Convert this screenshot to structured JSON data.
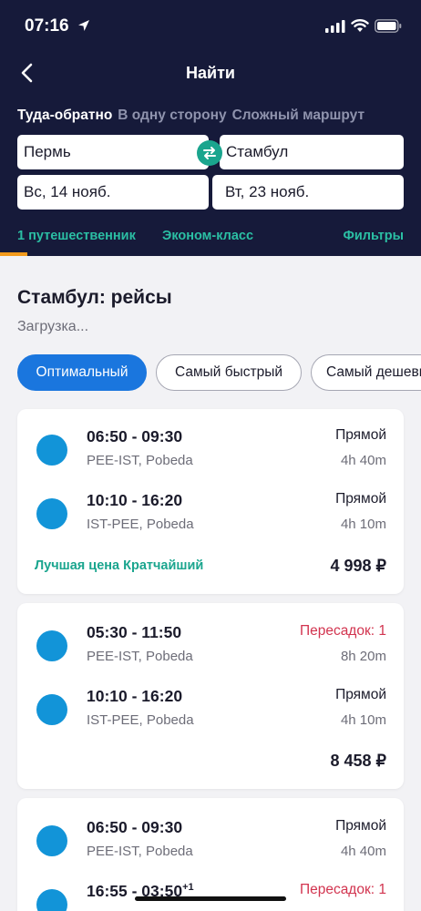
{
  "status_bar": {
    "time": "07:16"
  },
  "nav": {
    "title": "Найти"
  },
  "trip_tabs": [
    "Туда-обратно",
    "В одну сторону",
    "Сложный маршрут"
  ],
  "search": {
    "from": "Пермь",
    "to": "Стамбул",
    "depart_date": "Вс, 14 нояб.",
    "return_date": "Вт, 23 нояб."
  },
  "options": {
    "travellers": "1 путешественник",
    "cabin_class": "Эконом-класс",
    "filters": "Фильтры"
  },
  "results": {
    "title": "Стамбул: рейсы",
    "status": "Загрузка..."
  },
  "sort_options": [
    "Оптимальный",
    "Самый быстрый",
    "Самый дешевый"
  ],
  "flights": [
    {
      "legs": [
        {
          "times": "06:50 - 09:30",
          "day_offset": "",
          "route": "PEE-IST, Pobeda",
          "stops": "Прямой",
          "duration": "4h 40m"
        },
        {
          "times": "10:10 - 16:20",
          "day_offset": "",
          "route": "IST-PEE, Pobeda",
          "stops": "Прямой",
          "duration": "4h 10m"
        }
      ],
      "badges": "Лучшая цена Кратчайший",
      "price": "4 998 ₽"
    },
    {
      "legs": [
        {
          "times": "05:30 - 11:50",
          "day_offset": "",
          "route": "PEE-IST, Pobeda",
          "stops": "Пересадок: 1",
          "duration": "8h 20m"
        },
        {
          "times": "10:10 - 16:20",
          "day_offset": "",
          "route": "IST-PEE, Pobeda",
          "stops": "Прямой",
          "duration": "4h 10m"
        }
      ],
      "badges": "",
      "price": "8 458 ₽"
    },
    {
      "legs": [
        {
          "times": "06:50 - 09:30",
          "day_offset": "",
          "route": "PEE-IST, Pobeda",
          "stops": "Прямой",
          "duration": "4h 40m"
        },
        {
          "times": "16:55 - 03:50",
          "day_offset": "+1",
          "route": "",
          "stops": "Пересадок: 1",
          "duration": ""
        }
      ],
      "badges": "",
      "price": ""
    }
  ],
  "colors": {
    "header_bg": "#161a3a",
    "accent_teal": "#1aa58e",
    "accent_blue": "#1a76de",
    "transfer_red": "#d2344f",
    "tab_indicator": "#f39a1b",
    "airline_logo": "#1294d8"
  },
  "icons": [
    "location-arrow-icon",
    "signal-icon",
    "wifi-icon",
    "battery-icon",
    "back-chevron-icon",
    "swap-icon"
  ]
}
